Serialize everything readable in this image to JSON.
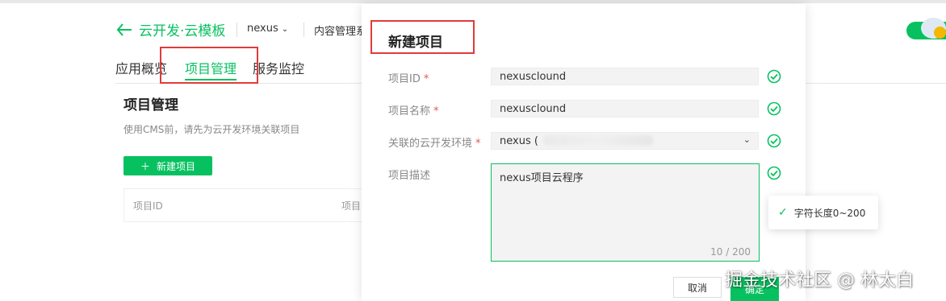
{
  "header": {
    "app_title": "云开发·云模板",
    "env_name": "nexus",
    "content_mgmt": "内容管理系"
  },
  "nav": {
    "tabs": [
      "应用概览",
      "项目管理",
      "服务监控"
    ],
    "active": "项目管理"
  },
  "page": {
    "title": "项目管理",
    "desc": "使用CMS前，请先为云开发环境关联项目",
    "new_button": "新建项目",
    "table_headers": [
      "项目ID",
      "项目"
    ]
  },
  "modal": {
    "title": "新建项目",
    "fields": [
      {
        "label": "项目ID",
        "required_mark": "*",
        "value": "nexusclound"
      },
      {
        "label": "项目名称",
        "required_mark": "*",
        "value": "nexusclound"
      },
      {
        "label": "关联的云开发环境",
        "required_mark": "*",
        "value": "nexus ("
      },
      {
        "label": "项目描述",
        "value": "nexus项目云程序"
      }
    ],
    "counter": "10 / 200",
    "cancel": "取消",
    "confirm": "确定"
  },
  "tooltip": {
    "text": "字符长度0~200"
  },
  "watermark": "掘金技术社区 @ 林太白",
  "colors": {
    "accent": "#07c160",
    "highlight": "#e03b3b"
  }
}
